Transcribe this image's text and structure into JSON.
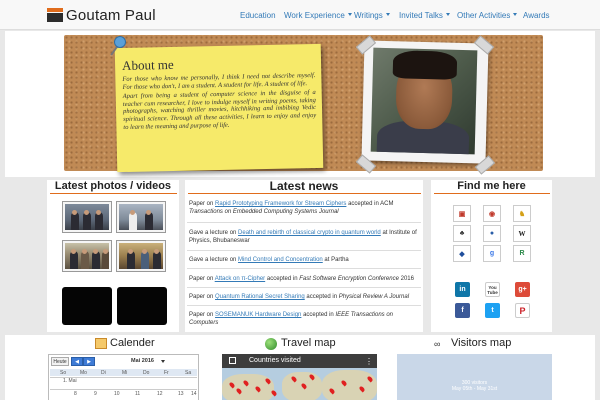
{
  "brand": {
    "name": "Goutam Paul"
  },
  "nav": {
    "education": "Education",
    "work": "Work Experience",
    "writings": "Writings",
    "invited": "Invited Talks",
    "other": "Other Activities",
    "awards": "Awards"
  },
  "about": {
    "title": "About me",
    "p1": "For those who know me personally, I think I need not describe myself. For those who don't, I am a student. A student for life. A student of life.",
    "p2": "Apart from being a student of computer science in the disguise of a teacher cum researcher, I love to indulge myself in writing poems, taking photographs, watching thriller movies, hitchhiking and imbibing Vedic spiritual science. Through all these activities, I learn to enjoy and enjoy to learn the meaning and purpose of life."
  },
  "sections": {
    "photos": "Latest photos / videos",
    "news": "Latest news",
    "findme": "Find me here",
    "calendar": "Calender",
    "travel": "Travel map",
    "visitors": "Visitors map"
  },
  "news": [
    {
      "pre": "Paper on ",
      "link": "Rapid Prototyping Framework for Stream Ciphers",
      "post": " accepted in ACM ",
      "ital": "Transactions on Embedded Computing Systems Journal"
    },
    {
      "pre": "Gave a lecture on ",
      "link": "Death and rebirth of classical crypto in quantum world",
      "post": " at Institute of Physics, Bhubaneswar",
      "ital": ""
    },
    {
      "pre": "Gave a lecture on ",
      "link": "Mind Control and Concentration",
      "post": " at Partha",
      "ital": ""
    },
    {
      "pre": "Paper on ",
      "link": "Attack on π-Cipher",
      "post": " accepted in ",
      "ital": "Fast Software Encryption Conference",
      "post2": " 2016"
    },
    {
      "pre": "Paper on ",
      "link": "Quantum Rational Secret Sharing",
      "post": " accepted in ",
      "ital": "Physical Review A Journal"
    },
    {
      "pre": "Paper on ",
      "link": "SOSEMANUK Hardware Design",
      "post": " accepted in ",
      "ital": "IEEE Transactions on Computers"
    }
  ],
  "calendar": {
    "today": "Heute",
    "month": "Mai 2016",
    "days": [
      "So",
      "Mo",
      "Di",
      "Mi",
      "Do",
      "Fr",
      "Sa"
    ],
    "row1": [
      "",
      "1. Mai",
      "",
      "",
      "",
      "",
      ""
    ],
    "row2": [
      "",
      "8",
      "9",
      "10",
      "11",
      "12",
      "13",
      "14"
    ]
  },
  "travel": {
    "header": "Countries visited"
  },
  "visitors": {
    "line1": "300 visitors",
    "line2": "May 05th - May 31st"
  },
  "social": {
    "linkedin": "in",
    "youtube": "You Tube",
    "gplus": "g+",
    "facebook": "f",
    "twitter": "t",
    "pinterest": "P"
  }
}
